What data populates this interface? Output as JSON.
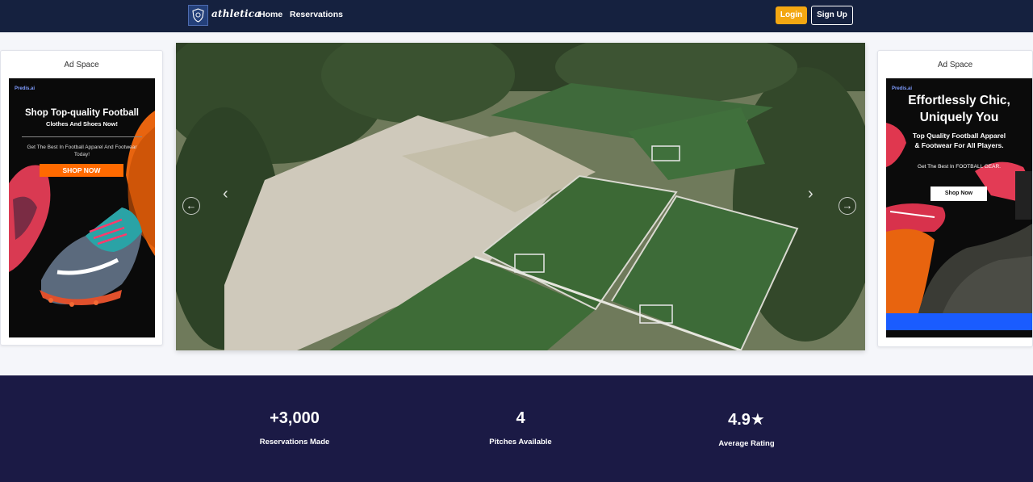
{
  "navbar": {
    "brand": "athletica",
    "links": [
      "Home",
      "Reservations"
    ],
    "login_label": "Login",
    "signup_label": "Sign Up"
  },
  "ads": {
    "left": {
      "title": "Ad Space",
      "brand": "Predis.ai",
      "headline": "Shop Top-quality Football",
      "subheadline": "Clothes And Shoes Now!",
      "body": "Get The Best In Football Apparel And Footwear Today!",
      "cta": "SHOP NOW"
    },
    "right": {
      "title": "Ad Space",
      "brand": "Predis.ai",
      "headline_line1": "Effortlessly Chic,",
      "headline_line2": "Uniquely You",
      "subheadline_line1": "Top Quality Football Apparel",
      "subheadline_line2": "& Footwear For All Players.",
      "body": "Get The Best In FOOTBALL GEAR.",
      "cta": "Shop Now"
    }
  },
  "carousel": {
    "prev_icon": "arrow-left-circle-icon",
    "next_icon": "arrow-right-circle-icon"
  },
  "stats": [
    {
      "value": "+3,000",
      "label": "Reservations Made"
    },
    {
      "value": "4",
      "label": "Pitches Available"
    },
    {
      "value": "4.9★",
      "label": "Average Rating"
    }
  ],
  "colors": {
    "navbar_bg": "#15213f",
    "login_bg": "#f3a712",
    "stats_bg": "#1b1a45",
    "page_bg": "#f5f6fa"
  }
}
